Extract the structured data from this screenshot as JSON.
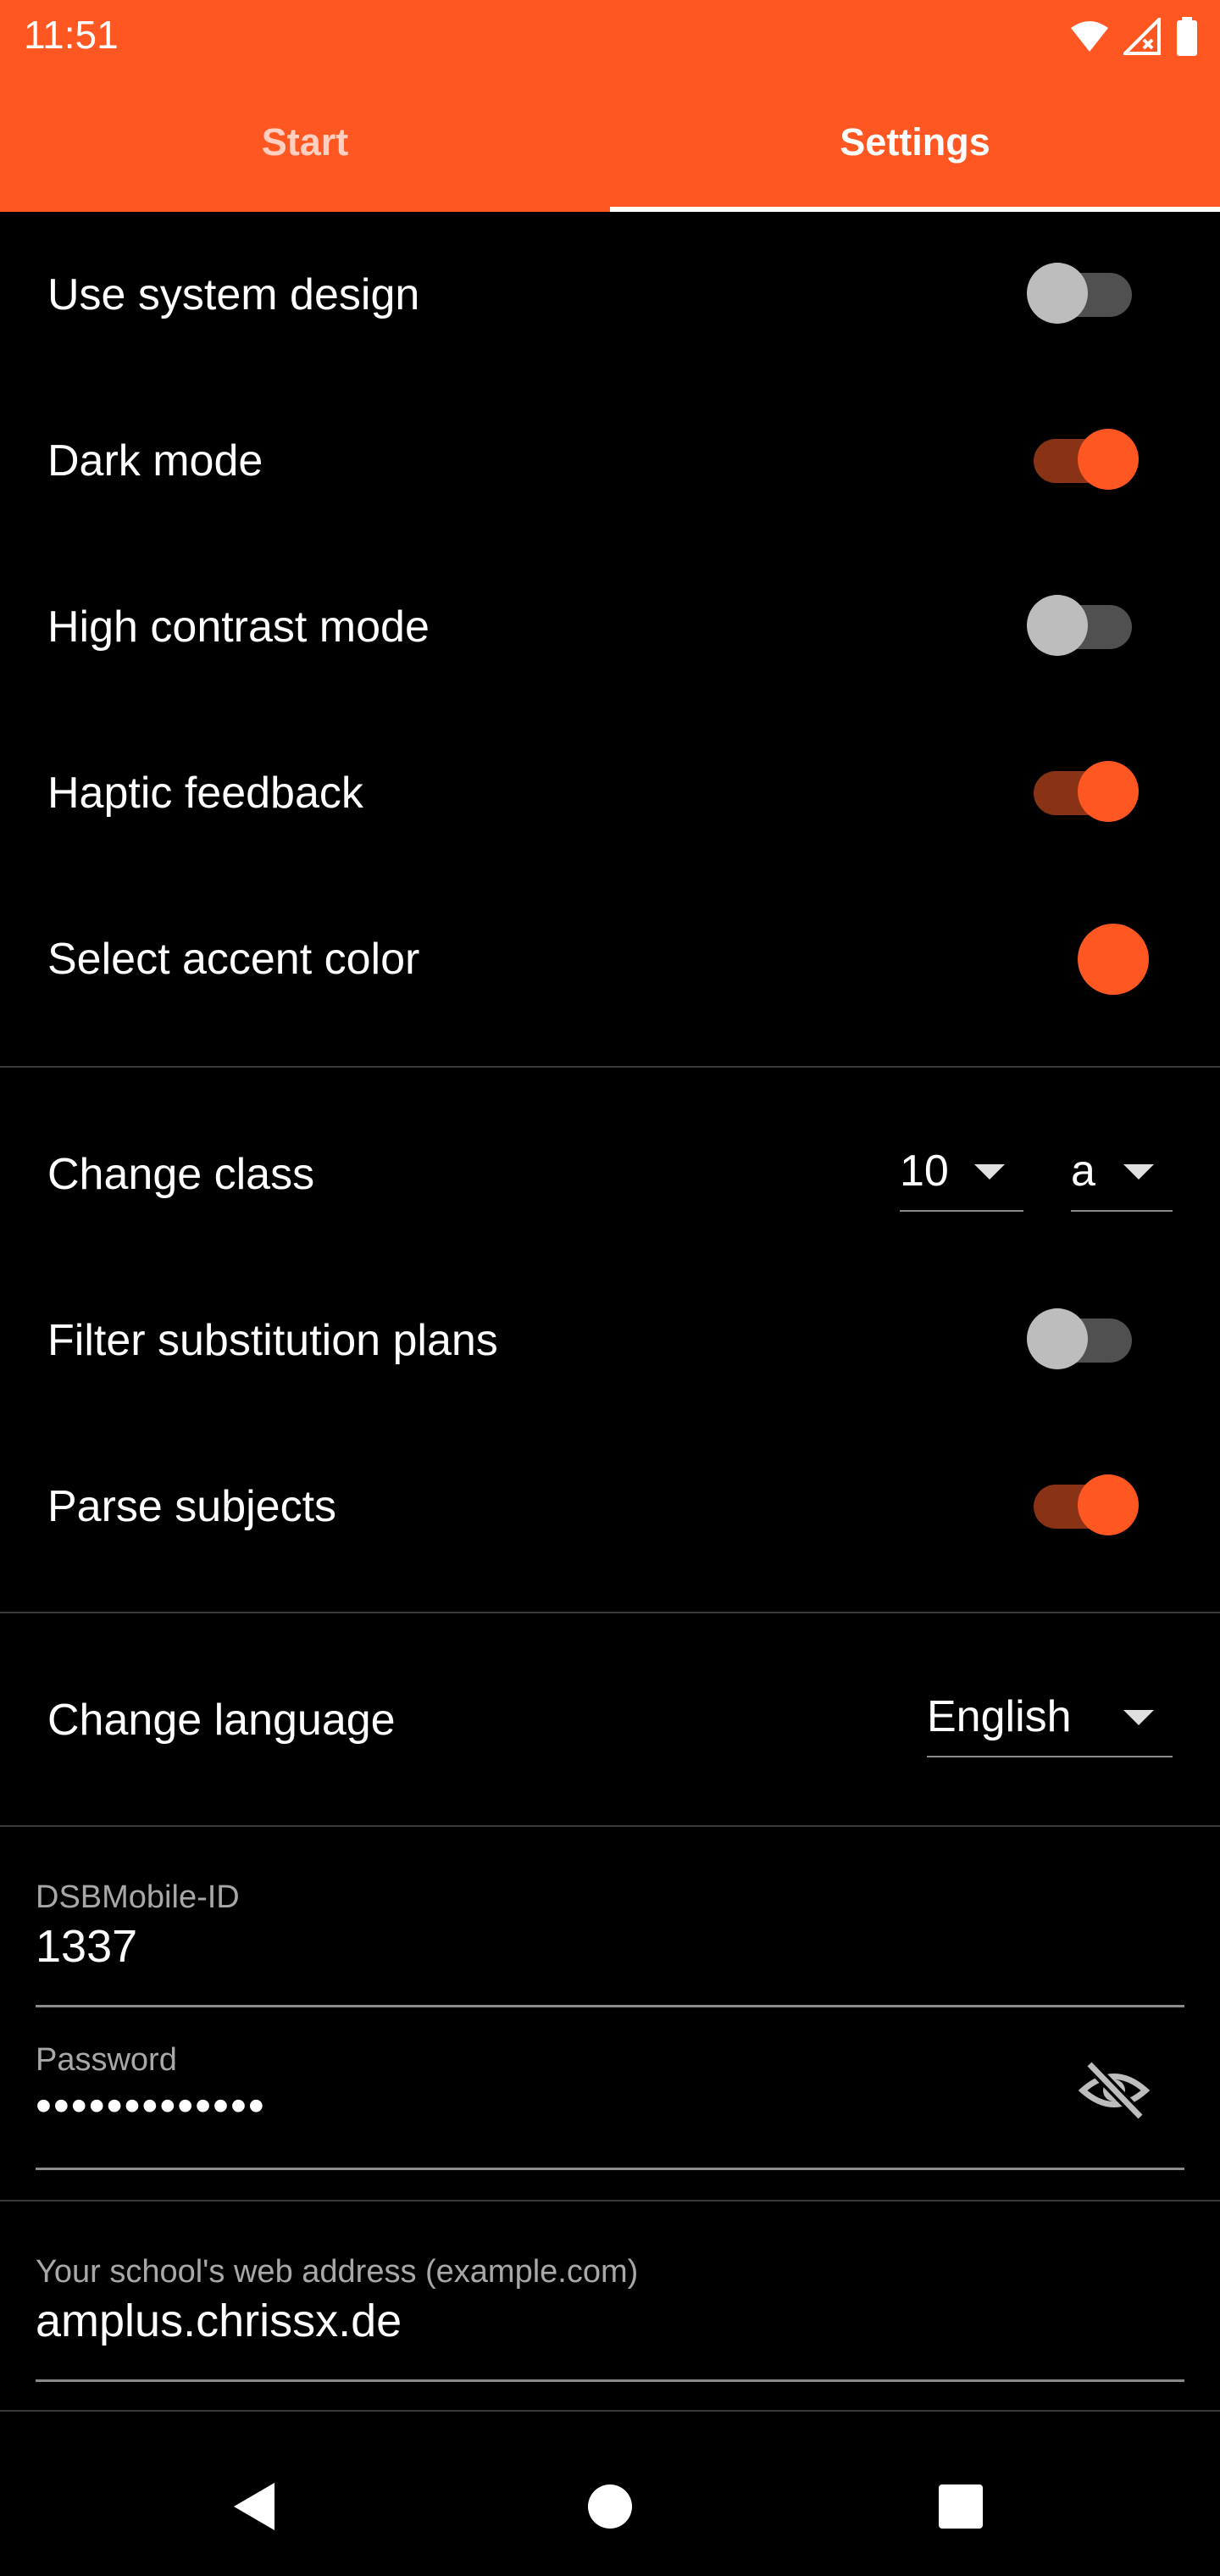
{
  "status_bar": {
    "time": "11:51",
    "icons": [
      "wifi-icon",
      "signal-off-icon",
      "battery-icon"
    ]
  },
  "tabs": [
    {
      "label": "Start",
      "selected": false
    },
    {
      "label": "Settings",
      "selected": true
    }
  ],
  "colors": {
    "accent": "#ff5722",
    "background": "#000000",
    "track_on": "#8a3216",
    "track_off": "#505050",
    "thumb_off": "#bdbdbd"
  },
  "settings": {
    "use_system_design": {
      "label": "Use system design",
      "on": false
    },
    "dark_mode": {
      "label": "Dark mode",
      "on": true
    },
    "high_contrast": {
      "label": "High contrast mode",
      "on": false
    },
    "haptic_feedback": {
      "label": "Haptic feedback",
      "on": true
    },
    "accent_color": {
      "label": "Select accent color",
      "color": "#ff5722"
    }
  },
  "class": {
    "label": "Change class",
    "grade": "10",
    "letter": "a"
  },
  "filter_plans": {
    "label": "Filter substitution plans",
    "on": false
  },
  "parse_subjects": {
    "label": "Parse subjects",
    "on": true
  },
  "language": {
    "label": "Change language",
    "value": "English"
  },
  "credentials": {
    "id_label": "DSBMobile-ID",
    "id_value": "1337",
    "password_label": "Password",
    "password_value": "•••••••••••••"
  },
  "school": {
    "label": "Your school's web address (example.com)",
    "value": "amplus.chrissx.de"
  },
  "nav": [
    "back-icon",
    "home-icon",
    "recents-icon"
  ]
}
